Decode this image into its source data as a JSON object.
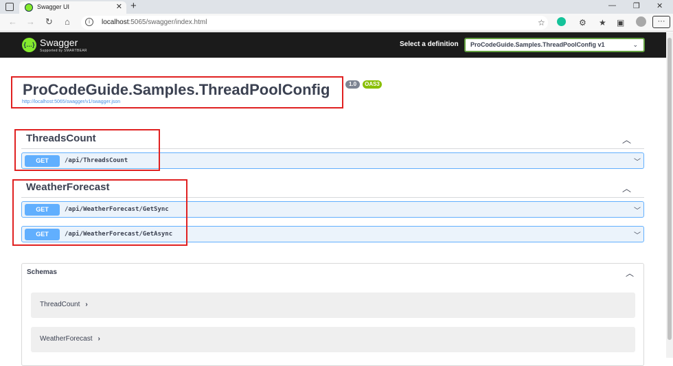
{
  "browser": {
    "tab_title": "Swagger UI",
    "tab_close": "✕",
    "new_tab": "+",
    "url_host": "localhost",
    "url_path": ":5065/swagger/index.html",
    "win_min": "—",
    "win_restore": "❐",
    "win_close": "✕",
    "more": "···"
  },
  "swagger": {
    "logo_name": "Swagger",
    "logo_sub": "Supported by SMARTBEAR",
    "definition_label": "Select a definition",
    "definition_selected": "ProCodeGuide.Samples.ThreadPoolConfig v1"
  },
  "info": {
    "title": "ProCodeGuide.Samples.ThreadPoolConfig",
    "version": "1.0",
    "oas": "OAS3",
    "spec_url": "http://localhost:5065/swagger/v1/swagger.json"
  },
  "tags": [
    {
      "name": "ThreadsCount",
      "ops": [
        {
          "method": "GET",
          "path": "/api/ThreadsCount"
        }
      ]
    },
    {
      "name": "WeatherForecast",
      "ops": [
        {
          "method": "GET",
          "path": "/api/WeatherForecast/GetSync"
        },
        {
          "method": "GET",
          "path": "/api/WeatherForecast/GetAsync"
        }
      ]
    }
  ],
  "schemas": {
    "title": "Schemas",
    "models": [
      "ThreadCount",
      "WeatherForecast"
    ]
  },
  "colors": {
    "get": "#61affe",
    "highlight": "#e02020",
    "topbar": "#1b1b1b",
    "brand": "#85ea2d"
  }
}
